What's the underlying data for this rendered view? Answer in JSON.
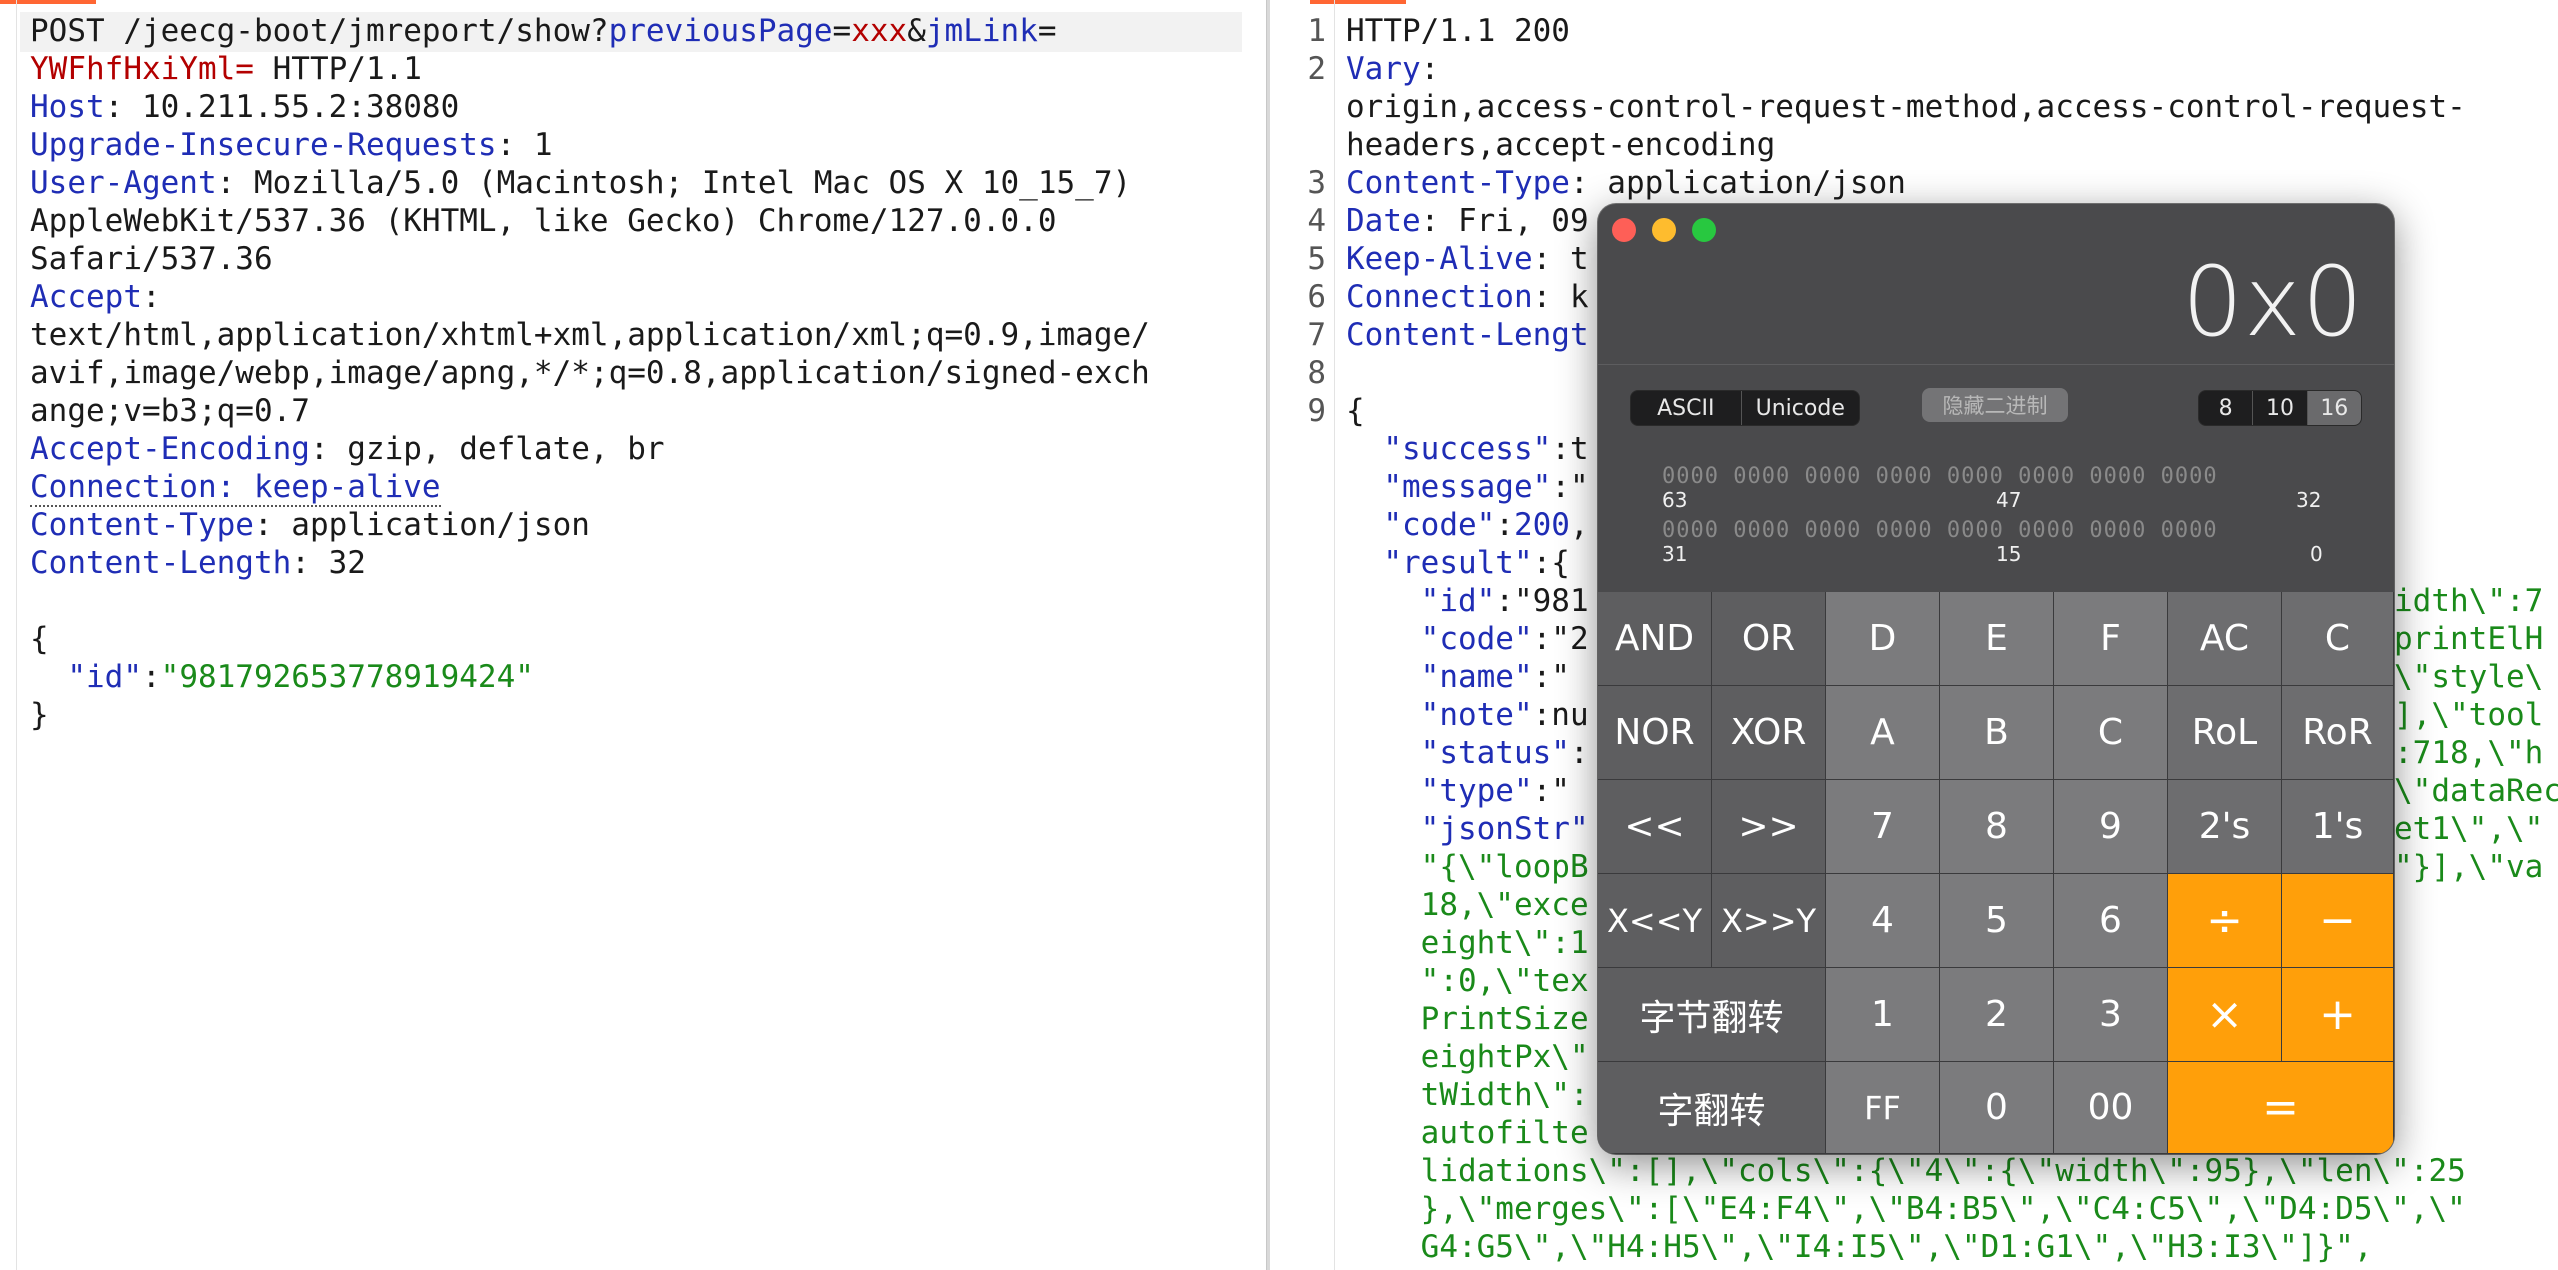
{
  "request": {
    "line1_method": "POST /jeecg-boot/jmreport/show?",
    "line1_param1": "previousPage",
    "line1_eq1": "=",
    "line1_val1": "xxx",
    "line1_amp": "&",
    "line1_param2": "jmLink",
    "line1_eq2": "=",
    "line2_val": "YWFhfHxiYml=",
    "line2_proto": " HTTP/1.1",
    "host_key": "Host",
    "host_val": ": 10.211.55.2:38080",
    "uir_key": "Upgrade-Insecure-Requests",
    "uir_val": ": 1",
    "ua_key": "User-Agent",
    "ua_val1": ": Mozilla/5.0 (Macintosh; Intel Mac OS X 10_15_7)",
    "ua_val2": "AppleWebKit/537.36 (KHTML, like Gecko) Chrome/127.0.0.0",
    "ua_val3": "Safari/537.36",
    "accept_key": "Accept",
    "accept_colon": ":",
    "accept_val1": "text/html,application/xhtml+xml,application/xml;q=0.9,image/",
    "accept_val2": "avif,image/webp,image/apng,*/*;q=0.8,application/signed-exch",
    "accept_val3": "ange;v=b3;q=0.7",
    "ae_key": "Accept-Encoding",
    "ae_val": ": gzip, deflate, br",
    "conn_text": "Connection: keep-alive",
    "ct_key": "Content-Type",
    "ct_val": ": application/json",
    "cl_key": "Content-Length",
    "cl_val": ": 32",
    "body_open": "{",
    "body_key": "\"id\"",
    "body_colon": ":",
    "body_val": "\"981792653778919424\"",
    "body_close": "}"
  },
  "response": {
    "line_numbers": [
      "1",
      "2",
      "3",
      "4",
      "5",
      "6",
      "7",
      "8",
      "9"
    ],
    "status_line": "HTTP/1.1 200",
    "vary_key": "Vary",
    "vary_colon": ":",
    "vary_val1": "origin,access-control-request-method,access-control-request-",
    "vary_val2": "headers,accept-encoding",
    "ct_key": "Content-Type",
    "ct_val": ": application/json",
    "date_key": "Date",
    "date_val": ": Fri, 09",
    "ka_key": "Keep-Alive",
    "ka_val": ": t",
    "conn_key": "Connection",
    "conn_val": ": k",
    "cl_key": "Content-Lengt",
    "brace_open": "{",
    "success_key": "\"success\"",
    "success_val": ":t",
    "message_key": "\"message\"",
    "message_val": ":\"",
    "code_key": "\"code\"",
    "code_colon": ":",
    "code_val": "200",
    "code_comma": ",",
    "result_key": "\"result\"",
    "result_val": ":{",
    "r_id_key": "\"id\"",
    "r_id_val": ":\"981",
    "r_code_key": "\"code\"",
    "r_code_val": ":\"2",
    "r_name_key": "\"name\"",
    "r_name_val": ":\"",
    "r_note_key": "\"note\"",
    "r_note_val": ":nu",
    "r_status_key": "\"status\"",
    "r_status_val": ":",
    "r_type_key": "\"type\"",
    "r_type_val": ":\"",
    "r_json_key": "\"jsonStr\"",
    "json_lines": [
      "\"{\\\"loopB",
      "18,\\\"exce",
      "eight\\\":1",
      "\":0,\\\"tex",
      "PrintSize",
      "eightPx\\\"",
      "tWidth\\\":",
      "autofilte",
      "lidations\\\":[],\\\"cols\\\":{\\\"4\\\":{\\\"width\\\":95},\\\"len\\\":25",
      "},\\\"merges\\\":[\\\"E4:F4\\\",\\\"B4:B5\\\",\\\"C4:C5\\\",\\\"D4:D5\\\",\\\"",
      "G4:G5\\\",\\\"H4:H5\\\",\\\"I4:I5\\\",\\\"D1:G1\\\",\\\"H3:I3\\\"]}\","
    ],
    "json_right": [
      "idth\\\":7",
      "printElH",
      "\\\"style\\",
      "],\\\"tool",
      ":718,\\\"h",
      "\\\"dataRec",
      "et1\\\",\\\"",
      "\"}],\\\"va"
    ]
  },
  "calculator": {
    "display": "0x0",
    "encoding_options": [
      "ASCII",
      "Unicode"
    ],
    "hide_binary_label": "隐藏二进制",
    "base_options": [
      "8",
      "10",
      "16"
    ],
    "selected_base": "16",
    "bits_row1": "0000 0000 0000 0000 0000 0000 0000 0000",
    "bits_row2": "0000 0000 0000 0000 0000 0000 0000 0000",
    "bit_labels_row1": [
      "63",
      "47",
      "32"
    ],
    "bit_labels_row2": [
      "31",
      "15",
      "0"
    ],
    "keys": {
      "and": "AND",
      "or": "OR",
      "d": "D",
      "e": "E",
      "f": "F",
      "ac": "AC",
      "c": "C",
      "nor": "NOR",
      "xor": "XOR",
      "a": "A",
      "b": "B",
      "c2": "C",
      "rol": "RoL",
      "ror": "RoR",
      "shl": "<<",
      "shr": ">>",
      "seven": "7",
      "eight": "8",
      "nine": "9",
      "twos": "2's",
      "ones": "1's",
      "xshl": "X<<Y",
      "xshr": "X>>Y",
      "four": "4",
      "five": "5",
      "six": "6",
      "div": "÷",
      "minus": "−",
      "byte_flip": "字节翻转",
      "one": "1",
      "two": "2",
      "three": "3",
      "times": "×",
      "plus": "+",
      "word_flip": "字翻转",
      "ff": "FF",
      "zero": "0",
      "dzero": "00",
      "equals": "="
    },
    "colors": {
      "operator": "#ff9f0a",
      "window": "#4a4a4c"
    }
  },
  "colors": {
    "key_color": "#1f2db5",
    "string_color": "#1a8a1a",
    "red_value": "#b30000",
    "tab_accent": "#ff6633"
  }
}
